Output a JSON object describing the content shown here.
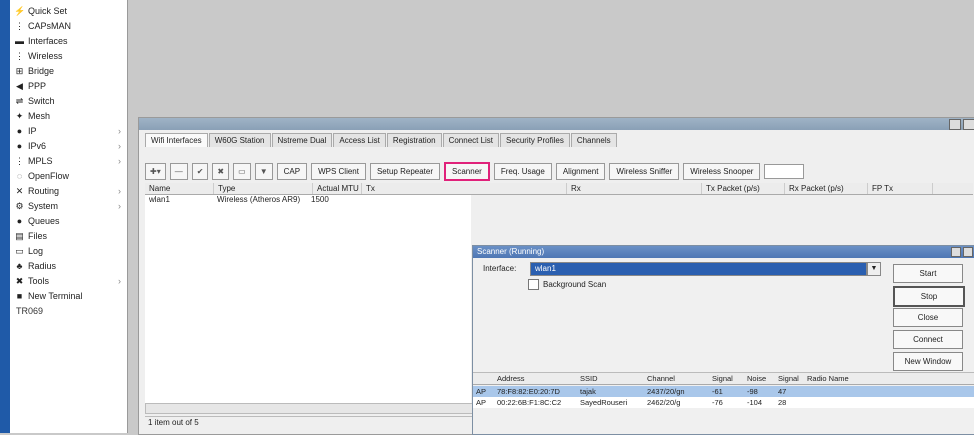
{
  "sidebar": {
    "items": [
      {
        "icon": "quickset-icon",
        "glyph": "⚡",
        "label": "Quick Set",
        "arrow": ""
      },
      {
        "icon": "capsman-icon",
        "glyph": "⋮",
        "label": "CAPsMAN",
        "arrow": ""
      },
      {
        "icon": "interfaces-icon",
        "glyph": "▬",
        "label": "Interfaces",
        "arrow": ""
      },
      {
        "icon": "wireless-icon",
        "glyph": "⋮",
        "label": "Wireless",
        "arrow": ""
      },
      {
        "icon": "bridge-icon",
        "glyph": "⊞",
        "label": "Bridge",
        "arrow": ""
      },
      {
        "icon": "ppp-icon",
        "glyph": "◀",
        "label": "PPP",
        "arrow": ""
      },
      {
        "icon": "switch-icon",
        "glyph": "⇌",
        "label": "Switch",
        "arrow": ""
      },
      {
        "icon": "mesh-icon",
        "glyph": "✦",
        "label": "Mesh",
        "arrow": ""
      },
      {
        "icon": "ip-icon",
        "glyph": "●",
        "label": "IP",
        "arrow": "›"
      },
      {
        "icon": "ipv6-icon",
        "glyph": "●",
        "label": "IPv6",
        "arrow": "›"
      },
      {
        "icon": "mpls-icon",
        "glyph": "⋮",
        "label": "MPLS",
        "arrow": "›"
      },
      {
        "icon": "openflow-icon",
        "glyph": "◌",
        "label": "OpenFlow",
        "arrow": ""
      },
      {
        "icon": "routing-icon",
        "glyph": "✕",
        "label": "Routing",
        "arrow": "›"
      },
      {
        "icon": "system-icon",
        "glyph": "⚙",
        "label": "System",
        "arrow": "›"
      },
      {
        "icon": "queues-icon",
        "glyph": "●",
        "label": "Queues",
        "arrow": ""
      },
      {
        "icon": "files-icon",
        "glyph": "▤",
        "label": "Files",
        "arrow": ""
      },
      {
        "icon": "log-icon",
        "glyph": "▭",
        "label": "Log",
        "arrow": ""
      },
      {
        "icon": "radius-icon",
        "glyph": "♣",
        "label": "Radius",
        "arrow": ""
      },
      {
        "icon": "tools-icon",
        "glyph": "✖",
        "label": "Tools",
        "arrow": "›"
      },
      {
        "icon": "terminal-icon",
        "glyph": "■",
        "label": "New Terminal",
        "arrow": ""
      }
    ],
    "board": "TR069"
  },
  "window": {
    "tabs": [
      "Wifi Interfaces",
      "W60G Station",
      "Nstreme Dual",
      "Access List",
      "Registration",
      "Connect List",
      "Security Profiles",
      "Channels"
    ],
    "toolbar": [
      "CAP",
      "WPS Client",
      "Setup Repeater",
      "Scanner",
      "Freq. Usage",
      "Alignment",
      "Wireless Sniffer",
      "Wireless Snooper"
    ],
    "columns": [
      "Name",
      "Type",
      "Actual MTU",
      "Tx",
      "Rx",
      "Tx Packet (p/s)",
      "Rx Packet (p/s)",
      "FP Tx"
    ],
    "row": {
      "name": "wlan1",
      "type": "Wireless (Atheros AR9)",
      "mtu": "1500"
    },
    "status": "1 item out of 5"
  },
  "scanner": {
    "title": "Scanner (Running)",
    "interface_label": "Interface:",
    "interface_value": "wlan1",
    "background_scan": "Background Scan",
    "buttons": [
      "Start",
      "Stop",
      "Close",
      "Connect",
      "New Window"
    ],
    "columns": [
      "",
      "Address",
      "SSID",
      "Channel",
      "Signal",
      "Noise",
      "Signal",
      "Radio Name"
    ],
    "rows": [
      [
        "AP",
        "78:F8:82:E0:20:7D",
        "tajak",
        "2437/20/gn",
        "-61",
        "-98",
        "47",
        ""
      ],
      [
        "AP",
        "00:22:6B:F1:8C:C2",
        "SayedRouseri",
        "2462/20/g",
        "-76",
        "-104",
        "28",
        ""
      ]
    ]
  }
}
